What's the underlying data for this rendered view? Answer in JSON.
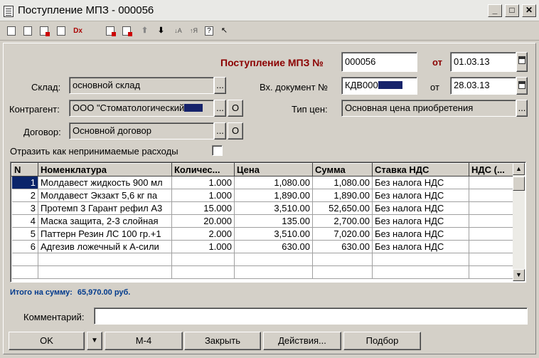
{
  "window": {
    "title": "Поступление МПЗ - 000056",
    "controls": {
      "minimize": "_",
      "maximize": "□",
      "close": "✕"
    }
  },
  "toolbar": {
    "icons": [
      "new-doc-icon",
      "copy-doc-icon",
      "delete-doc-icon",
      "copy-row-icon",
      "mark-delete-icon",
      "edit-icon",
      "move-row-icon",
      "move-up-icon",
      "move-down-icon",
      "sort-asc-icon",
      "sort-desc-icon",
      "help-icon",
      "pointer-help-icon"
    ]
  },
  "header": {
    "doc_title": "Поступление МПЗ №",
    "doc_number": "000056",
    "from_label": "от",
    "doc_date": "01.03.13",
    "incoming_label": "Вх. документ №",
    "incoming_number": "КДВ000",
    "incoming_date": "28.03.13"
  },
  "form": {
    "warehouse_label": "Склад:",
    "warehouse_value": "основной склад",
    "counterparty_label": "Контрагент:",
    "counterparty_value": "ООО \"Стоматологический",
    "contract_label": "Договор:",
    "contract_value": "Основной договор",
    "price_type_label": "Тип цен:",
    "price_type_value": "Основная цена приобретения",
    "nondeductible_label": "Отразить как непринимаемые расходы",
    "select_btn": "...",
    "open_btn": "О"
  },
  "table": {
    "columns": [
      "N",
      "Номенклатура",
      "Количес...",
      "Цена",
      "Сумма",
      "Ставка НДС",
      "НДС (..."
    ],
    "rows": [
      {
        "n": "1",
        "item": "Молдавест жидкость 900 мл",
        "qty": "1.000",
        "price": "1,080.00",
        "sum": "1,080.00",
        "vat_rate": "Без налога НДС",
        "vat": ""
      },
      {
        "n": "2",
        "item": "Молдавест Экзакт 5,6 кг па",
        "qty": "1.000",
        "price": "1,890.00",
        "sum": "1,890.00",
        "vat_rate": "Без налога НДС",
        "vat": ""
      },
      {
        "n": "3",
        "item": "Протемп 3 Гарант рефил А3",
        "qty": "15.000",
        "price": "3,510.00",
        "sum": "52,650.00",
        "vat_rate": "Без налога НДС",
        "vat": ""
      },
      {
        "n": "4",
        "item": "Маска защита, 2-3 слойная",
        "qty": "20.000",
        "price": "135.00",
        "sum": "2,700.00",
        "vat_rate": "Без налога НДС",
        "vat": ""
      },
      {
        "n": "5",
        "item": "Паттерн Резин ЛС 100 гр.+1",
        "qty": "2.000",
        "price": "3,510.00",
        "sum": "7,020.00",
        "vat_rate": "Без налога НДС",
        "vat": ""
      },
      {
        "n": "6",
        "item": "Адгезив ложечный к А-сили",
        "qty": "1.000",
        "price": "630.00",
        "sum": "630.00",
        "vat_rate": "Без налога НДС",
        "vat": ""
      }
    ]
  },
  "summary": {
    "total_label": "Итого на сумму:",
    "total_value": "65,970.00 руб."
  },
  "comment": {
    "label": "Комментарий:",
    "value": ""
  },
  "buttons": {
    "ok": "OK",
    "dropdown": "▼",
    "m4": "М-4",
    "close": "Закрыть",
    "actions": "Действия...",
    "pick": "Подбор"
  }
}
